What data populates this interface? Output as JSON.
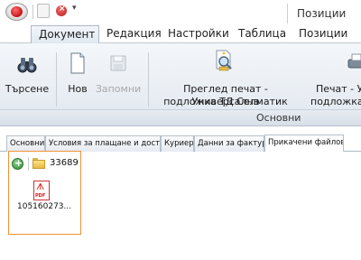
{
  "app": {
    "context_tab": "Позиции",
    "qat": {
      "dropdown_glyph": "▾"
    }
  },
  "ribbon": {
    "tabs": [
      {
        "label": "Документ",
        "active": true
      },
      {
        "label": "Редакция",
        "active": false
      },
      {
        "label": "Настройки",
        "active": false
      },
      {
        "label": "Таблица",
        "active": false
      },
      {
        "label": "Позиции",
        "active": false
      }
    ],
    "buttons": {
      "search": "Търсене",
      "new": "Нов",
      "save": "Запомни",
      "print_preview_line1": "Преглед печат - Универсална",
      "print_preview_line2": "подложка ТД Селматик",
      "print_line1": "Печат - У",
      "print_line2": "подложка"
    },
    "group_label": "Основни"
  },
  "document_tabs": [
    {
      "label": "Основни",
      "active": false
    },
    {
      "label": "Условия за плащане и доставка",
      "active": false
    },
    {
      "label": "Куриер",
      "active": false
    },
    {
      "label": "Данни за фактура",
      "active": false
    },
    {
      "label": "Прикачени файлове",
      "active": true
    }
  ],
  "attachments": {
    "folder_name": "33689",
    "files": [
      {
        "name": "105160273...",
        "type": "pdf"
      }
    ]
  },
  "colors": {
    "highlight_border": "#f39136",
    "accent": "#c0151a"
  }
}
